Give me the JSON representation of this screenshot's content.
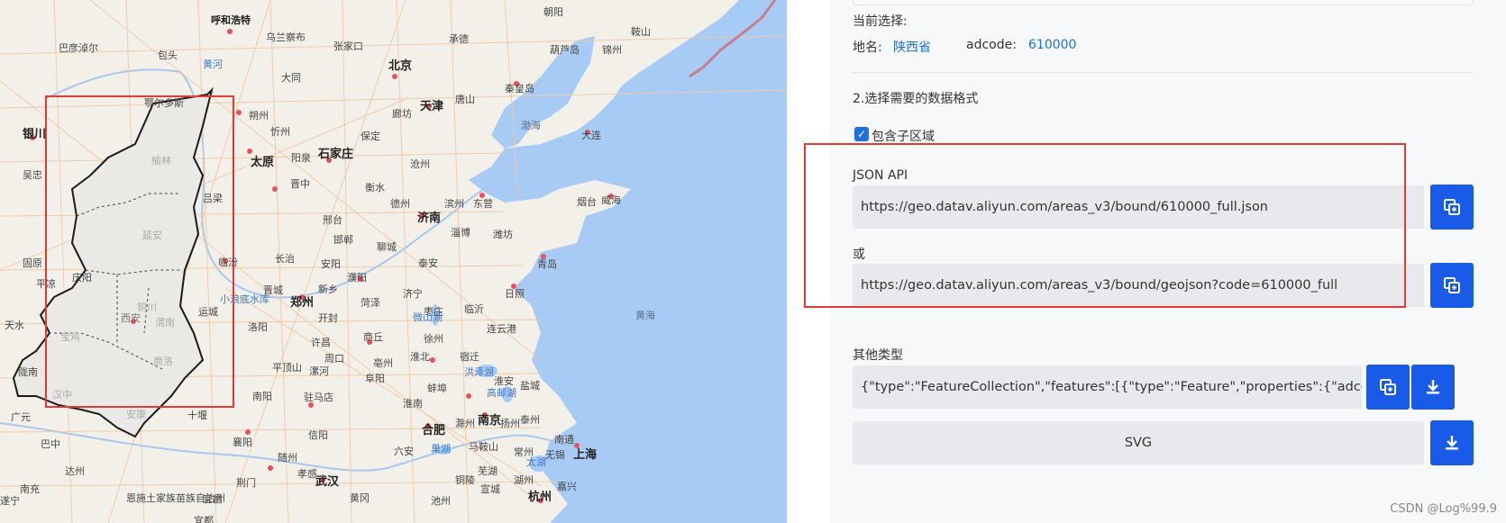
{
  "map": {
    "cities": [
      {
        "name": "呼和浩特",
        "big": false
      },
      {
        "name": "北京",
        "big": true
      },
      {
        "name": "天津",
        "big": true
      },
      {
        "name": "石家庄",
        "big": true
      },
      {
        "name": "太原",
        "big": true
      },
      {
        "name": "银川",
        "big": true
      },
      {
        "name": "济南",
        "big": true
      },
      {
        "name": "郑州",
        "big": true
      },
      {
        "name": "西安",
        "big": false
      },
      {
        "name": "合肥",
        "big": true
      },
      {
        "name": "南京",
        "big": true
      },
      {
        "name": "武汉",
        "big": true
      },
      {
        "name": "杭州",
        "big": true
      },
      {
        "name": "上海",
        "big": true
      },
      {
        "name": "乌兰察布",
        "big": false
      },
      {
        "name": "张家口",
        "big": false
      },
      {
        "name": "承德",
        "big": false
      },
      {
        "name": "秦皇岛",
        "big": false
      },
      {
        "name": "唐山",
        "big": false
      },
      {
        "name": "廊坊",
        "big": false
      },
      {
        "name": "保定",
        "big": false
      },
      {
        "name": "沧州",
        "big": false
      },
      {
        "name": "衡水",
        "big": false
      },
      {
        "name": "德州",
        "big": false
      },
      {
        "name": "滨州",
        "big": false
      },
      {
        "name": "东营",
        "big": false
      },
      {
        "name": "淄博",
        "big": false
      },
      {
        "name": "潍坊",
        "big": false
      },
      {
        "name": "烟台",
        "big": false
      },
      {
        "name": "威海",
        "big": false
      },
      {
        "name": "青岛",
        "big": false
      },
      {
        "name": "日照",
        "big": false
      },
      {
        "name": "大连",
        "big": false
      },
      {
        "name": "葫芦岛",
        "big": false
      },
      {
        "name": "锦州",
        "big": false
      },
      {
        "name": "朝阳",
        "big": false
      },
      {
        "name": "鞍山",
        "big": false
      },
      {
        "name": "巴彦淖尔",
        "big": false
      },
      {
        "name": "包头",
        "big": false
      },
      {
        "name": "鄂尔多斯",
        "big": false
      },
      {
        "name": "大同",
        "big": false
      },
      {
        "name": "朔州",
        "big": false
      },
      {
        "name": "忻州",
        "big": false
      },
      {
        "name": "阳泉",
        "big": false
      },
      {
        "name": "晋中",
        "big": false
      },
      {
        "name": "吕梁",
        "big": false
      },
      {
        "name": "临汾",
        "big": false
      },
      {
        "name": "长治",
        "big": false
      },
      {
        "name": "晋城",
        "big": false
      },
      {
        "name": "运城",
        "big": false
      },
      {
        "name": "邢台",
        "big": false
      },
      {
        "name": "邯郸",
        "big": false
      },
      {
        "name": "聊城",
        "big": false
      },
      {
        "name": "泰安",
        "big": false
      },
      {
        "name": "安阳",
        "big": false
      },
      {
        "name": "新乡",
        "big": false
      },
      {
        "name": "濮阳",
        "big": false
      },
      {
        "name": "济宁",
        "big": false
      },
      {
        "name": "菏泽",
        "big": false
      },
      {
        "name": "枣庄",
        "big": false
      },
      {
        "name": "临沂",
        "big": false
      },
      {
        "name": "连云港",
        "big": false
      },
      {
        "name": "开封",
        "big": false
      },
      {
        "name": "洛阳",
        "big": false
      },
      {
        "name": "许昌",
        "big": false
      },
      {
        "name": "商丘",
        "big": false
      },
      {
        "name": "徐州",
        "big": false
      },
      {
        "name": "宿迁",
        "big": false
      },
      {
        "name": "淮北",
        "big": false
      },
      {
        "name": "亳州",
        "big": false
      },
      {
        "name": "周口",
        "big": false
      },
      {
        "name": "平顶山",
        "big": false
      },
      {
        "name": "漯河",
        "big": false
      },
      {
        "name": "阜阳",
        "big": false
      },
      {
        "name": "驻马店",
        "big": false
      },
      {
        "name": "南阳",
        "big": false
      },
      {
        "name": "信阳",
        "big": false
      },
      {
        "name": "六安",
        "big": false
      },
      {
        "name": "襄阳",
        "big": false
      },
      {
        "name": "随州",
        "big": false
      },
      {
        "name": "十堰",
        "big": false
      },
      {
        "name": "荆门",
        "big": false
      },
      {
        "name": "宜昌",
        "big": false
      },
      {
        "name": "黄冈",
        "big": false
      },
      {
        "name": "孝感",
        "big": false
      },
      {
        "name": "盐城",
        "big": false
      },
      {
        "name": "淮安",
        "big": false
      },
      {
        "name": "扬州",
        "big": false
      },
      {
        "name": "泰州",
        "big": false
      },
      {
        "name": "南通",
        "big": false
      },
      {
        "name": "无锡",
        "big": false
      },
      {
        "name": "常州",
        "big": false
      },
      {
        "name": "湖州",
        "big": false
      },
      {
        "name": "嘉兴",
        "big": false
      },
      {
        "name": "宣城",
        "big": false
      },
      {
        "name": "池州",
        "big": false
      },
      {
        "name": "铜陵",
        "big": false
      },
      {
        "name": "芜湖",
        "big": false
      },
      {
        "name": "马鞍山",
        "big": false
      },
      {
        "name": "滁州",
        "big": false
      },
      {
        "name": "蚌埠",
        "big": false
      },
      {
        "name": "淮南",
        "big": false
      },
      {
        "name": "吴忠",
        "big": false
      },
      {
        "name": "固原",
        "big": false
      },
      {
        "name": "庆阳",
        "big": false
      },
      {
        "name": "天水",
        "big": false
      },
      {
        "name": "平凉",
        "big": false
      },
      {
        "name": "陇南",
        "big": false
      },
      {
        "name": "广元",
        "big": false
      },
      {
        "name": "巴中",
        "big": false
      },
      {
        "name": "达州",
        "big": false
      },
      {
        "name": "南充",
        "big": false
      },
      {
        "name": "遂宁",
        "big": false
      },
      {
        "name": "恩施土家族苗族自治州",
        "big": false
      },
      {
        "name": "宜都",
        "big": false
      },
      {
        "name": "榆林",
        "big": false
      },
      {
        "name": "延安",
        "big": false
      },
      {
        "name": "宝鸡",
        "big": false
      },
      {
        "name": "汉中",
        "big": false
      },
      {
        "name": "安康",
        "big": false
      },
      {
        "name": "商洛",
        "big": false
      },
      {
        "name": "渭南",
        "big": false
      },
      {
        "name": "铜川",
        "big": false
      }
    ],
    "water_labels": [
      "黄河",
      "小浪底水库",
      "微山湖",
      "洪泽湖",
      "高邮湖",
      "巢湖",
      "太湖"
    ],
    "sea_labels": [
      "渤海",
      "黄海"
    ]
  },
  "panel": {
    "current_selection_label": "当前选择:",
    "place_label": "地名:",
    "place_value": "陕西省",
    "adcode_label": "adcode:",
    "adcode_value": "610000",
    "step2_label": "2.选择需要的数据格式",
    "include_children_label": "包含子区域",
    "json_api_label": "JSON API",
    "json_api_url": "https://geo.datav.aliyun.com/areas_v3/bound/610000_full.json",
    "or_label": "或",
    "geojson_url": "https://geo.datav.aliyun.com/areas_v3/bound/geojson?code=610000_full",
    "other_types_label": "其他类型",
    "other_json_preview": "{\"type\":\"FeatureCollection\",\"features\":[{\"type\":\"Feature\",\"properties\":{\"adcode",
    "svg_label": "SVG"
  },
  "watermark": "CSDN @Log%99.9",
  "colors": {
    "accent": "#1a5ae8",
    "link": "#1f6fe0",
    "highlight_box": "#e53935",
    "sea": "#a8cbf5",
    "land": "#f3f0e9"
  }
}
